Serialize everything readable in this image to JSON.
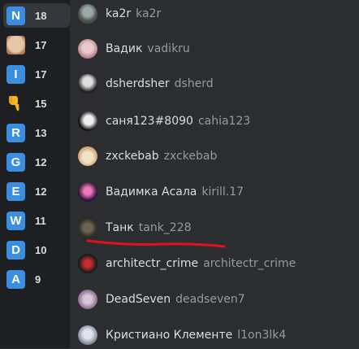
{
  "reactions": [
    {
      "letter": "N",
      "count": "18",
      "color": "#3b8de0"
    },
    {
      "icon": "face-emoji",
      "count": "17"
    },
    {
      "letter": "I",
      "count": "17",
      "color": "#3b8de0"
    },
    {
      "icon": "thumbs-down-emoji",
      "count": "15"
    },
    {
      "letter": "R",
      "count": "13",
      "color": "#3b8de0"
    },
    {
      "letter": "G",
      "count": "12",
      "color": "#3b8de0"
    },
    {
      "letter": "E",
      "count": "12",
      "color": "#3b8de0"
    },
    {
      "letter": "W",
      "count": "11",
      "color": "#3b8de0"
    },
    {
      "letter": "D",
      "count": "10",
      "color": "#3b8de0"
    },
    {
      "letter": "A",
      "count": "9",
      "color": "#3b8de0"
    }
  ],
  "users": [
    {
      "name": "ka2r",
      "username": "ka2r"
    },
    {
      "name": "Вадик",
      "username": "vadikru"
    },
    {
      "name": "dsherdsher",
      "username": "dsherd"
    },
    {
      "name": "саня123#8090",
      "username": "cahia123"
    },
    {
      "name": "zxckebab",
      "username": "zxckebab"
    },
    {
      "name": "Вадимка Асала",
      "username": "kirill.17"
    },
    {
      "name": "Танк",
      "username": "tank_228"
    },
    {
      "name": "architectr_crime",
      "username": "architectr_crime"
    },
    {
      "name": "DeadSeven",
      "username": "deadseven7"
    },
    {
      "name": "Кристиано Клементе",
      "username": "l1on3lk4"
    }
  ],
  "colors": {
    "underline": "#e0101c",
    "letter_badge": "#3b8de0"
  }
}
